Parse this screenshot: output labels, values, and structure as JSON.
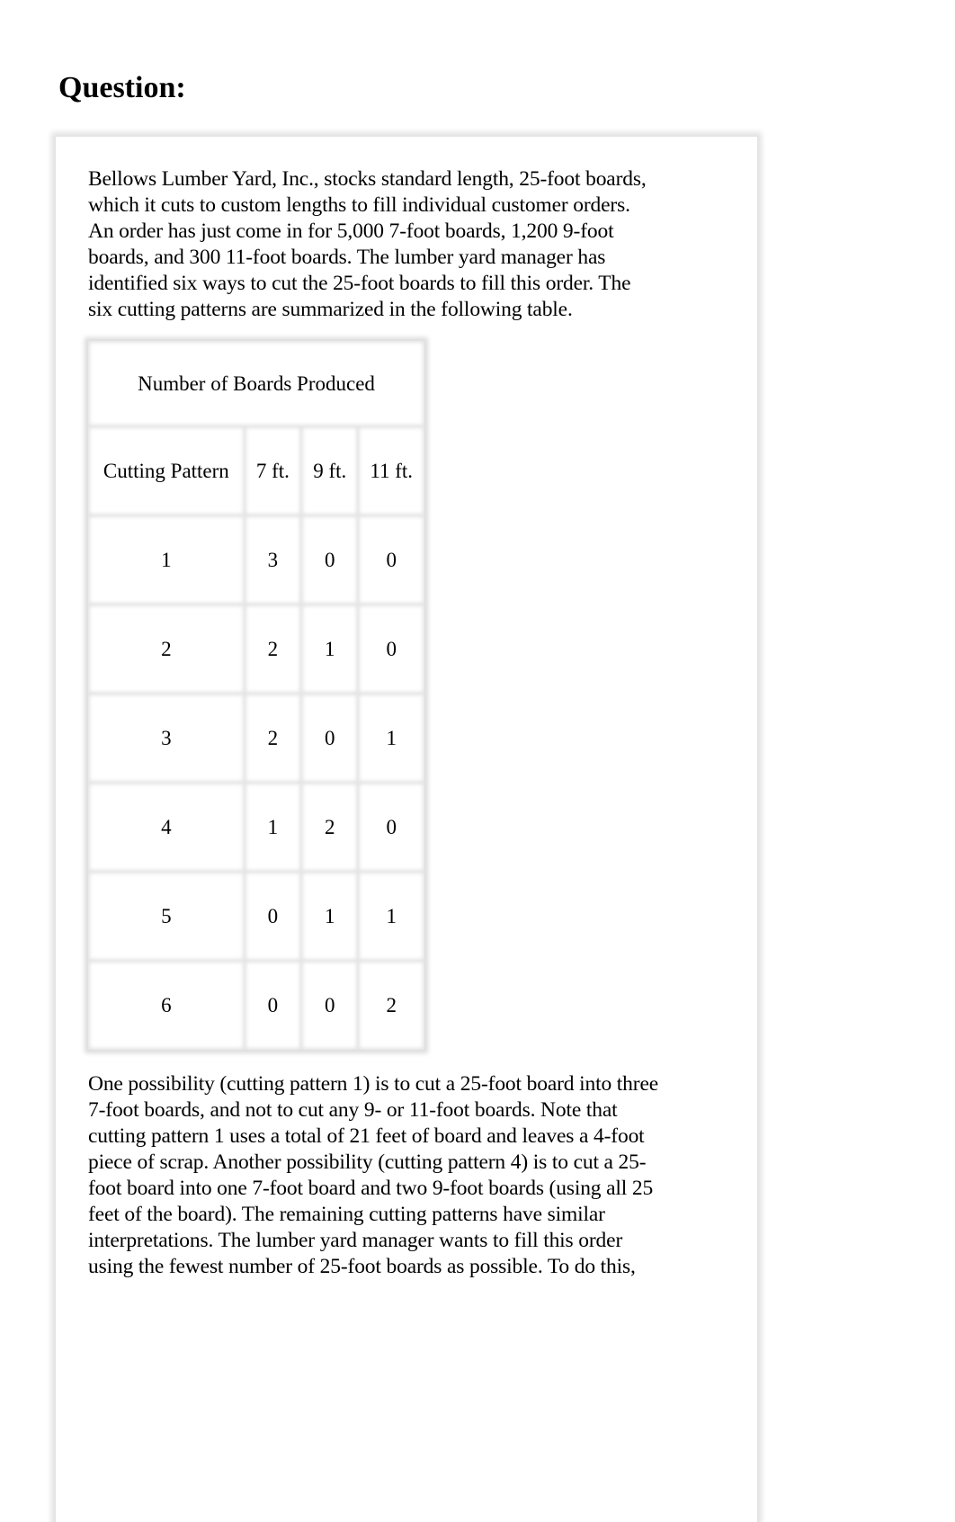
{
  "heading": "Question:",
  "intro_lines": [
    "Bellows Lumber Yard, Inc., stocks standard length, 25-foot boards,",
    "which it cuts to custom lengths to fill individual customer orders.",
    "An order has just come in for 5,000 7-foot boards, 1,200 9-foot",
    "boards, and 300 11-foot boards. The lumber yard manager has",
    "identified six ways to cut the 25-foot boards to fill this order. The",
    "six cutting patterns are summarized in the following table."
  ],
  "table": {
    "title": "Number of Boards Produced",
    "headers": [
      "Cutting Pattern",
      "7 ft.",
      "9 ft.",
      "11 ft."
    ],
    "rows": [
      [
        "1",
        "3",
        "0",
        "0"
      ],
      [
        "2",
        "2",
        "1",
        "0"
      ],
      [
        "3",
        "2",
        "0",
        "1"
      ],
      [
        "4",
        "1",
        "2",
        "0"
      ],
      [
        "5",
        "0",
        "1",
        "1"
      ],
      [
        "6",
        "0",
        "0",
        "2"
      ]
    ]
  },
  "followup_lines": [
    "One possibility (cutting pattern 1) is to cut a 25-foot board into three",
    "7-foot boards, and not to cut any 9- or 11-foot boards. Note that",
    "cutting pattern 1 uses a total of 21 feet of board and leaves a 4-foot",
    "piece of scrap. Another possibility (cutting pattern 4) is to cut a 25-",
    "foot board into one 7-foot board and two 9-foot boards (using all 25",
    "feet of the board). The remaining cutting patterns have similar",
    "interpretations. The lumber yard manager wants to fill this order",
    "using the fewest number of 25-foot boards as possible. To do this,"
  ]
}
